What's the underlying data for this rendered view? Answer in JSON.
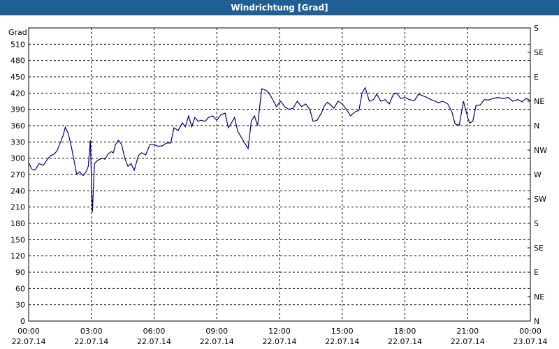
{
  "window": {
    "title": "Windrichtung [Grad]"
  },
  "chart_data": {
    "type": "line",
    "title": "Windrichtung [Grad]",
    "ylabel": "Grad",
    "xlabel": "",
    "ylim": [
      0,
      540
    ],
    "grid": true,
    "y_ticks": [
      0,
      30,
      60,
      90,
      120,
      150,
      180,
      210,
      240,
      270,
      300,
      330,
      360,
      390,
      420,
      450,
      480,
      510
    ],
    "right_ticks": [
      {
        "value": 0,
        "label": "N"
      },
      {
        "value": 45,
        "label": "NE"
      },
      {
        "value": 90,
        "label": "E"
      },
      {
        "value": 135,
        "label": "SE"
      },
      {
        "value": 180,
        "label": "S"
      },
      {
        "value": 225,
        "label": "SW"
      },
      {
        "value": 270,
        "label": "W"
      },
      {
        "value": 315,
        "label": "NW"
      },
      {
        "value": 360,
        "label": "N"
      },
      {
        "value": 405,
        "label": "NE"
      },
      {
        "value": 450,
        "label": "E"
      },
      {
        "value": 495,
        "label": "SE"
      },
      {
        "value": 540,
        "label": "S"
      }
    ],
    "x_ticks": [
      {
        "hour": 0,
        "time": "00:00",
        "date": "22.07.14"
      },
      {
        "hour": 3,
        "time": "03:00",
        "date": "22.07.14"
      },
      {
        "hour": 6,
        "time": "06:00",
        "date": "22.07.14"
      },
      {
        "hour": 9,
        "time": "09:00",
        "date": "22.07.14"
      },
      {
        "hour": 12,
        "time": "12:00",
        "date": "22.07.14"
      },
      {
        "hour": 15,
        "time": "15:00",
        "date": "22.07.14"
      },
      {
        "hour": 18,
        "time": "18:00",
        "date": "22.07.14"
      },
      {
        "hour": 21,
        "time": "21:00",
        "date": "22.07.14"
      },
      {
        "hour": 24,
        "time": "00:00",
        "date": "23.07.14"
      }
    ],
    "series": [
      {
        "color": "#000080",
        "points": [
          [
            0.0,
            292
          ],
          [
            0.15,
            280
          ],
          [
            0.3,
            278
          ],
          [
            0.5,
            290
          ],
          [
            0.7,
            287
          ],
          [
            0.9,
            298
          ],
          [
            1.05,
            305
          ],
          [
            1.2,
            307
          ],
          [
            1.35,
            313
          ],
          [
            1.5,
            327
          ],
          [
            1.65,
            342
          ],
          [
            1.75,
            357
          ],
          [
            1.9,
            345
          ],
          [
            2.05,
            320
          ],
          [
            2.2,
            290
          ],
          [
            2.3,
            270
          ],
          [
            2.45,
            275
          ],
          [
            2.6,
            268
          ],
          [
            2.75,
            275
          ],
          [
            2.85,
            285
          ],
          [
            2.95,
            333
          ],
          [
            3.05,
            200
          ],
          [
            3.15,
            290
          ],
          [
            3.3,
            296
          ],
          [
            3.5,
            300
          ],
          [
            3.65,
            298
          ],
          [
            3.8,
            308
          ],
          [
            3.95,
            312
          ],
          [
            4.05,
            310
          ],
          [
            4.15,
            325
          ],
          [
            4.3,
            333
          ],
          [
            4.45,
            325
          ],
          [
            4.6,
            300
          ],
          [
            4.75,
            285
          ],
          [
            4.9,
            290
          ],
          [
            5.05,
            278
          ],
          [
            5.25,
            305
          ],
          [
            5.4,
            310
          ],
          [
            5.6,
            306
          ],
          [
            5.8,
            325
          ],
          [
            6.0,
            325
          ],
          [
            6.2,
            322
          ],
          [
            6.4,
            323
          ],
          [
            6.6,
            328
          ],
          [
            6.8,
            328
          ],
          [
            6.95,
            356
          ],
          [
            7.15,
            351
          ],
          [
            7.35,
            365
          ],
          [
            7.5,
            358
          ],
          [
            7.65,
            378
          ],
          [
            7.8,
            358
          ],
          [
            7.95,
            375
          ],
          [
            8.1,
            368
          ],
          [
            8.25,
            370
          ],
          [
            8.45,
            368
          ],
          [
            8.6,
            375
          ],
          [
            8.8,
            378
          ],
          [
            9.0,
            370
          ],
          [
            9.2,
            380
          ],
          [
            9.4,
            383
          ],
          [
            9.55,
            356
          ],
          [
            9.7,
            365
          ],
          [
            9.85,
            375
          ],
          [
            10.0,
            350
          ],
          [
            10.15,
            340
          ],
          [
            10.3,
            330
          ],
          [
            10.5,
            318
          ],
          [
            10.65,
            368
          ],
          [
            10.8,
            378
          ],
          [
            10.95,
            360
          ],
          [
            11.15,
            428
          ],
          [
            11.35,
            425
          ],
          [
            11.5,
            420
          ],
          [
            11.65,
            410
          ],
          [
            11.85,
            395
          ],
          [
            12.05,
            405
          ],
          [
            12.25,
            395
          ],
          [
            12.45,
            390
          ],
          [
            12.65,
            392
          ],
          [
            12.85,
            405
          ],
          [
            13.05,
            395
          ],
          [
            13.25,
            400
          ],
          [
            13.45,
            390
          ],
          [
            13.6,
            368
          ],
          [
            13.8,
            370
          ],
          [
            14.0,
            383
          ],
          [
            14.15,
            397
          ],
          [
            14.3,
            403
          ],
          [
            14.45,
            398
          ],
          [
            14.6,
            392
          ],
          [
            14.8,
            405
          ],
          [
            15.0,
            400
          ],
          [
            15.2,
            390
          ],
          [
            15.4,
            378
          ],
          [
            15.6,
            385
          ],
          [
            15.8,
            388
          ],
          [
            15.95,
            420
          ],
          [
            16.1,
            430
          ],
          [
            16.3,
            405
          ],
          [
            16.5,
            408
          ],
          [
            16.65,
            418
          ],
          [
            16.85,
            405
          ],
          [
            17.05,
            408
          ],
          [
            17.25,
            400
          ],
          [
            17.45,
            418
          ],
          [
            17.6,
            420
          ],
          [
            17.8,
            410
          ],
          [
            18.0,
            412
          ],
          [
            18.2,
            408
          ],
          [
            18.45,
            406
          ],
          [
            18.65,
            418
          ],
          [
            18.85,
            415
          ],
          [
            19.05,
            412
          ],
          [
            19.25,
            408
          ],
          [
            19.45,
            405
          ],
          [
            19.6,
            402
          ],
          [
            19.8,
            405
          ],
          [
            20.05,
            400
          ],
          [
            20.25,
            385
          ],
          [
            20.4,
            363
          ],
          [
            20.6,
            361
          ],
          [
            20.8,
            405
          ],
          [
            21.0,
            375
          ],
          [
            21.1,
            365
          ],
          [
            21.25,
            368
          ],
          [
            21.4,
            397
          ],
          [
            21.6,
            398
          ],
          [
            21.8,
            408
          ],
          [
            22.0,
            407
          ],
          [
            22.2,
            410
          ],
          [
            22.45,
            412
          ],
          [
            22.7,
            410
          ],
          [
            22.95,
            412
          ],
          [
            23.15,
            405
          ],
          [
            23.4,
            408
          ],
          [
            23.6,
            404
          ],
          [
            23.8,
            410
          ],
          [
            24.0,
            406
          ]
        ]
      }
    ]
  }
}
